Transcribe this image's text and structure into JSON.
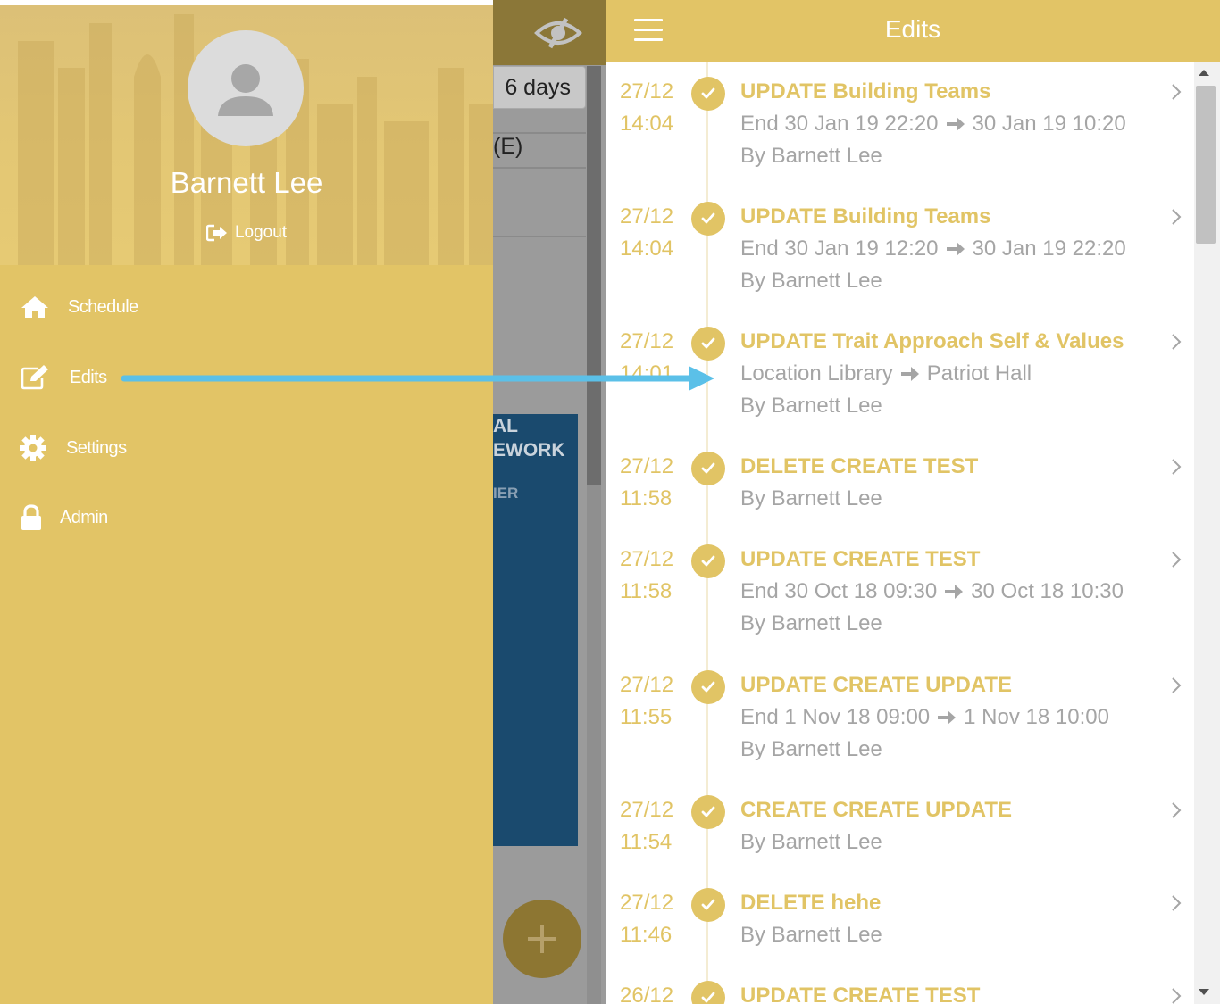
{
  "colors": {
    "accent": "#e2c466",
    "text_white": "#ffffff",
    "detail_grey": "#a5a5a5",
    "annotation_arrow": "#5bc0e8",
    "dim_card": "#1a4a6e"
  },
  "drawer": {
    "user_name": "Barnett Lee",
    "logout_label": "Logout",
    "menu": [
      {
        "label": "Schedule",
        "icon": "home-icon"
      },
      {
        "label": "Edits",
        "icon": "edit-icon"
      },
      {
        "label": "Settings",
        "icon": "gear-icon"
      },
      {
        "label": "Admin",
        "icon": "lock-icon"
      }
    ]
  },
  "background_view": {
    "range_button": "6 days",
    "column_label": "(E)",
    "card_line1": "AL",
    "card_line2": "EWORK",
    "card_line3": "IER"
  },
  "panel": {
    "title": "Edits",
    "entries": [
      {
        "date": "27/12",
        "time": "14:04",
        "title": "UPDATE Building Teams",
        "change_prefix": "End 30 Jan 19 22:20",
        "change_to": "30 Jan 19 10:20",
        "by": "By Barnett Lee"
      },
      {
        "date": "27/12",
        "time": "14:04",
        "title": "UPDATE Building Teams",
        "change_prefix": "End 30 Jan 19 12:20",
        "change_to": "30 Jan 19 22:20",
        "by": "By Barnett Lee"
      },
      {
        "date": "27/12",
        "time": "14:01",
        "title": "UPDATE Trait Approach Self & Values",
        "change_prefix": "Location Library",
        "change_to": "Patriot Hall",
        "by": "By Barnett Lee"
      },
      {
        "date": "27/12",
        "time": "11:58",
        "title": "DELETE CREATE TEST",
        "by": "By Barnett Lee"
      },
      {
        "date": "27/12",
        "time": "11:58",
        "title": "UPDATE CREATE TEST",
        "change_prefix": "End 30 Oct 18 09:30",
        "change_to": "30 Oct 18 10:30",
        "by": "By Barnett Lee"
      },
      {
        "date": "27/12",
        "time": "11:55",
        "title": "UPDATE CREATE UPDATE",
        "change_prefix": "End 1 Nov 18 09:00",
        "change_to": "1 Nov 18 10:00",
        "by": "By Barnett Lee"
      },
      {
        "date": "27/12",
        "time": "11:54",
        "title": "CREATE CREATE UPDATE",
        "by": "By Barnett Lee"
      },
      {
        "date": "27/12",
        "time": "11:46",
        "title": "DELETE hehe",
        "by": "By Barnett Lee"
      },
      {
        "date": "26/12",
        "time": "",
        "title": "UPDATE CREATE TEST"
      }
    ]
  }
}
